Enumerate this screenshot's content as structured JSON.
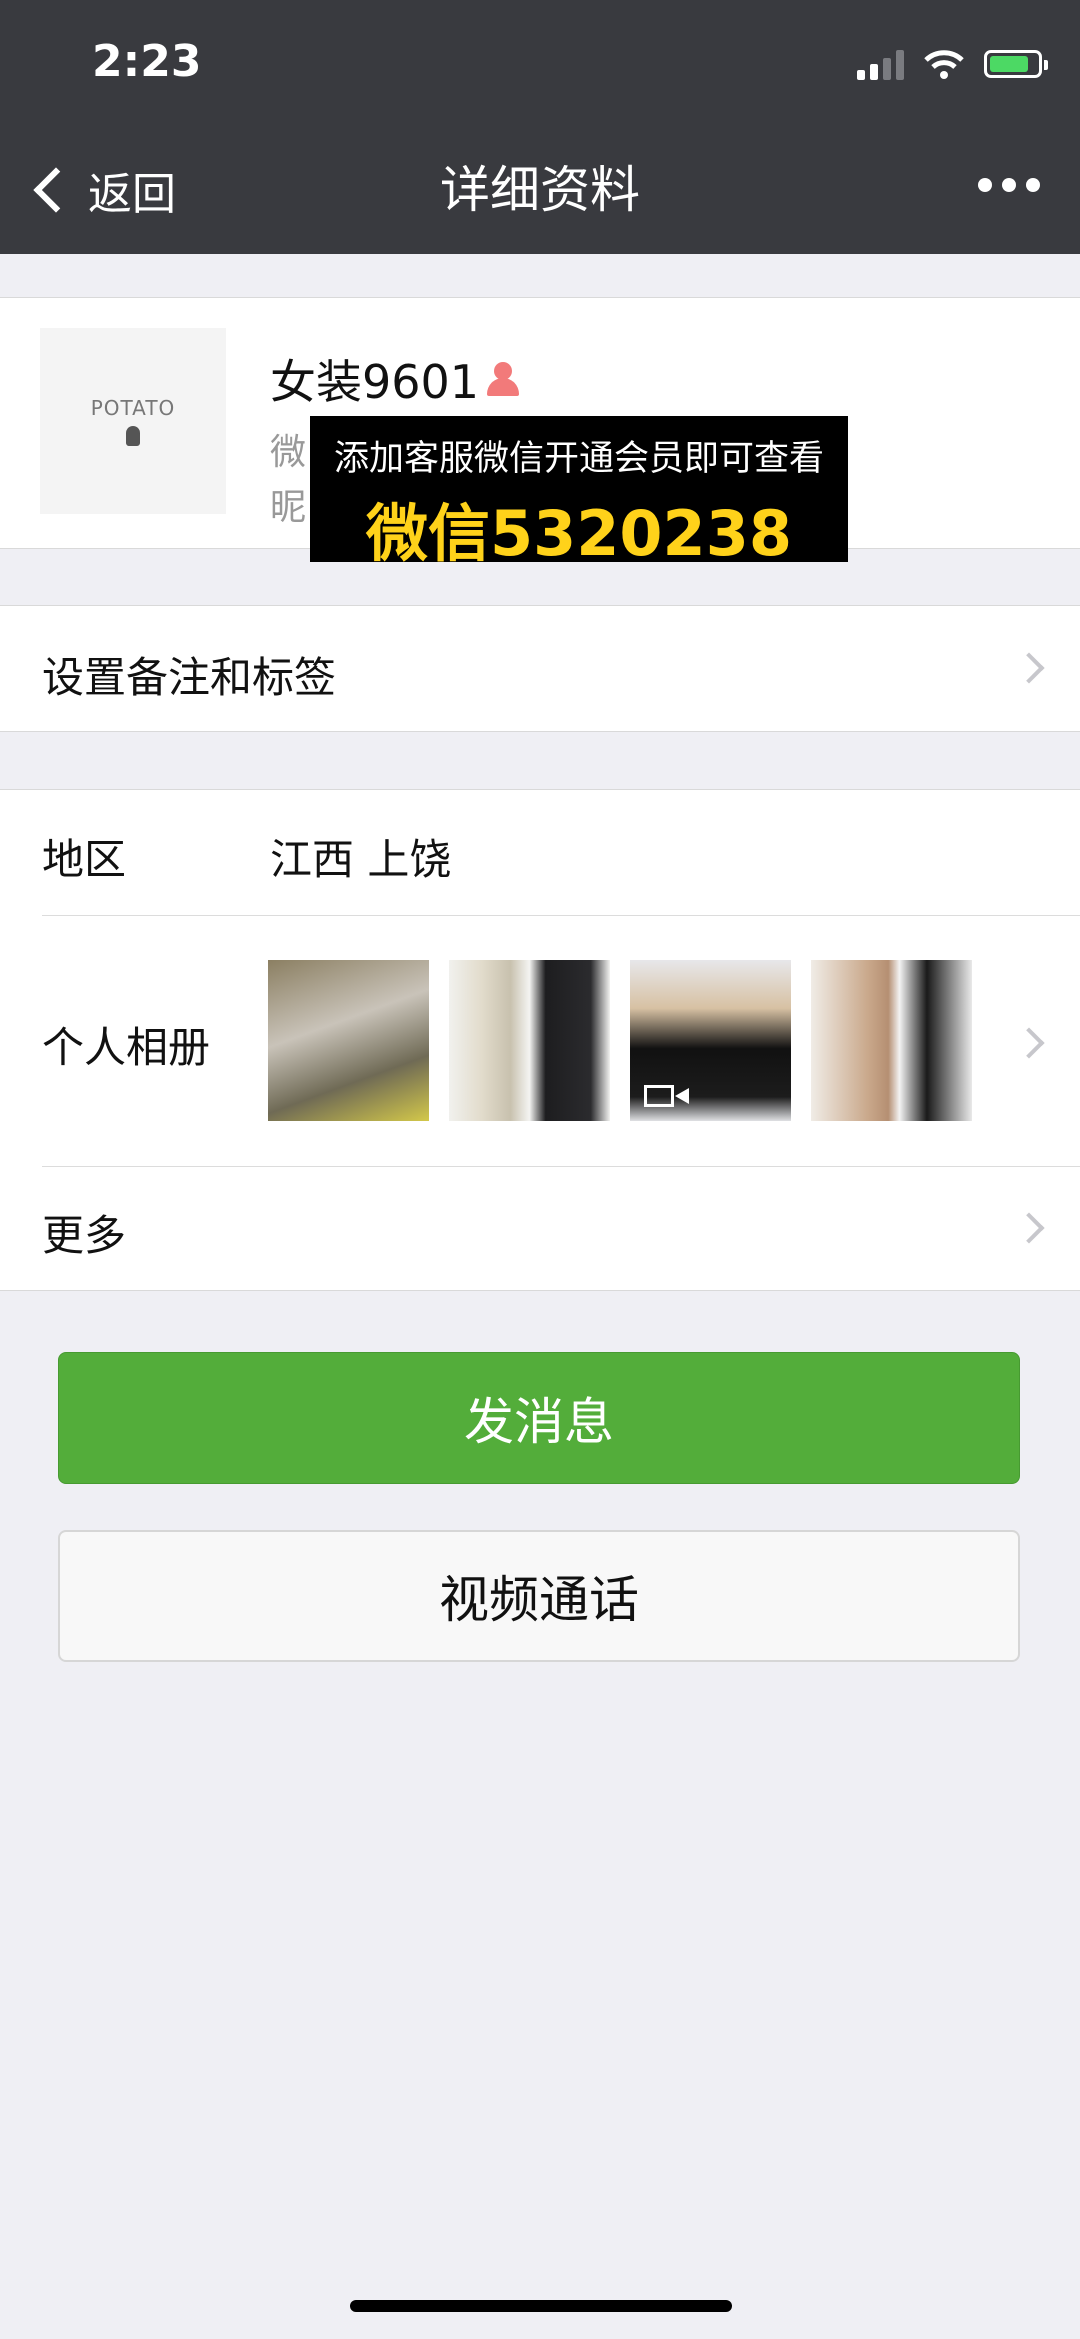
{
  "status_bar": {
    "time": "2:23"
  },
  "nav": {
    "back_label": "返回",
    "title": "详细资料"
  },
  "profile": {
    "avatar_text": "POTATO",
    "name": "女装9601",
    "wechat_id_prefix": "微",
    "nickname_prefix": "昵"
  },
  "overlay": {
    "line1": "添加客服微信开通会员即可查看",
    "line2": "微信5320238"
  },
  "rows": {
    "remark_label": "设置备注和标签",
    "region_label": "地区",
    "region_value": "江西 上饶",
    "album_label": "个人相册",
    "more_label": "更多"
  },
  "buttons": {
    "send_message": "发消息",
    "video_call": "视频通话"
  },
  "colors": {
    "accent_green": "#53ad3a",
    "header_bg": "#393a3f",
    "overlay_yellow": "#ffd21a"
  },
  "icons": [
    "back-chevron-icon",
    "more-dots-icon",
    "wifi-icon",
    "battery-icon",
    "signal-icon",
    "female-icon",
    "chevron-right-icon",
    "video-icon"
  ]
}
